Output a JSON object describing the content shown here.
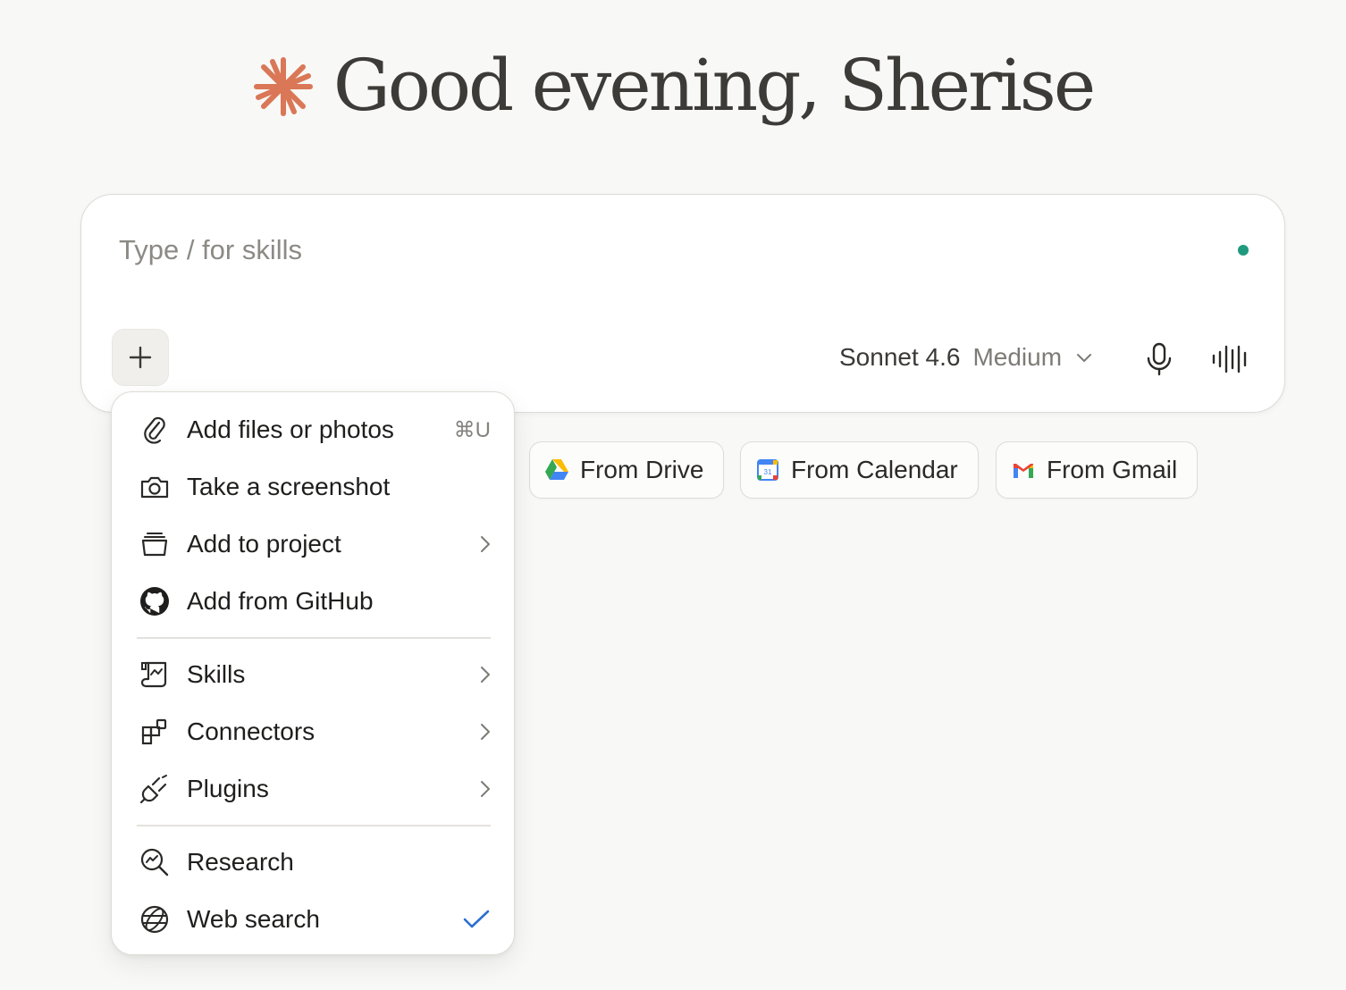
{
  "greeting": {
    "logo_icon": "sparkle-logo-icon",
    "logo_color": "#d97757",
    "text": "Good evening, Sherise"
  },
  "composer": {
    "placeholder": "Type / for skills",
    "status_color": "#1f9a7f",
    "plus_icon": "plus-icon",
    "model": {
      "name": "Sonnet 4.6",
      "effort": "Medium"
    },
    "mic_icon": "microphone-icon",
    "voice_icon": "voice-waveform-icon"
  },
  "chips": [
    {
      "label": "From Drive",
      "icon": "google-drive-icon"
    },
    {
      "label": "From Calendar",
      "icon": "google-calendar-icon"
    },
    {
      "label": "From Gmail",
      "icon": "gmail-icon"
    }
  ],
  "menu": {
    "items": [
      {
        "label": "Add files or photos",
        "icon": "paperclip-icon",
        "shortcut": "⌘U"
      },
      {
        "label": "Take a screenshot",
        "icon": "camera-icon"
      },
      {
        "label": "Add to project",
        "icon": "project-box-icon",
        "submenu": true
      },
      {
        "label": "Add from GitHub",
        "icon": "github-icon"
      },
      {
        "label": "Skills",
        "icon": "skills-scroll-icon",
        "submenu": true
      },
      {
        "label": "Connectors",
        "icon": "connectors-icon",
        "submenu": true
      },
      {
        "label": "Plugins",
        "icon": "plug-icon",
        "submenu": true
      },
      {
        "label": "Research",
        "icon": "research-icon"
      },
      {
        "label": "Web search",
        "icon": "globe-icon",
        "checked": true,
        "check_color": "#2b6fd1"
      }
    ]
  }
}
